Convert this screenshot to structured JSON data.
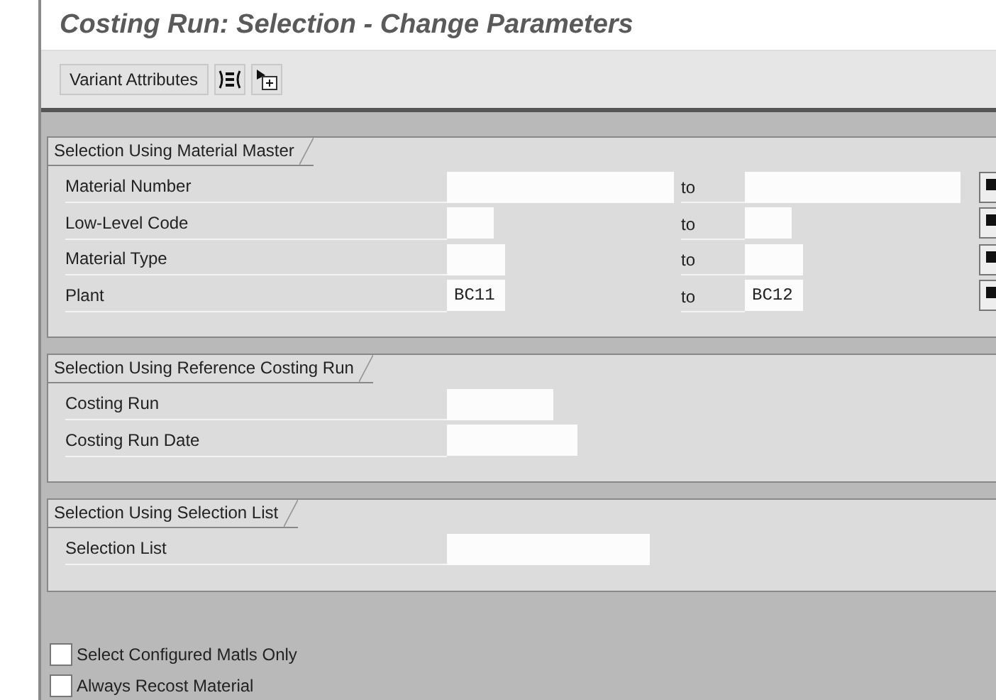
{
  "window": {
    "title": "Costing Run: Selection - Change Parameters"
  },
  "toolbar": {
    "buttons": [
      {
        "kind": "text",
        "label": "Variant Attributes"
      },
      {
        "kind": "icon"
      },
      {
        "kind": "icon"
      }
    ]
  },
  "groups": [
    {
      "title": "Selection Using Material Master",
      "rows": [
        {
          "label": "Material Number",
          "from": "",
          "to_label": "to",
          "to": ""
        },
        {
          "label": "Low-Level Code",
          "from": "",
          "to_label": "to",
          "to": ""
        },
        {
          "label": "Material Type",
          "from": "",
          "to_label": "to",
          "to": ""
        },
        {
          "label": "Plant",
          "from": "BC11",
          "to_label": "to",
          "to": "BC12"
        }
      ]
    },
    {
      "title": "Selection Using Reference Costing Run",
      "rows": [
        {
          "label": "Costing Run",
          "from": ""
        },
        {
          "label": "Costing Run Date",
          "from": ""
        }
      ]
    },
    {
      "title": "Selection Using Selection List",
      "rows": [
        {
          "label": "Selection List",
          "from": ""
        }
      ]
    }
  ],
  "options": [
    {
      "label": "Select Configured Matls Only",
      "checked": false
    },
    {
      "label": "Always Recost Material",
      "checked": false
    }
  ]
}
